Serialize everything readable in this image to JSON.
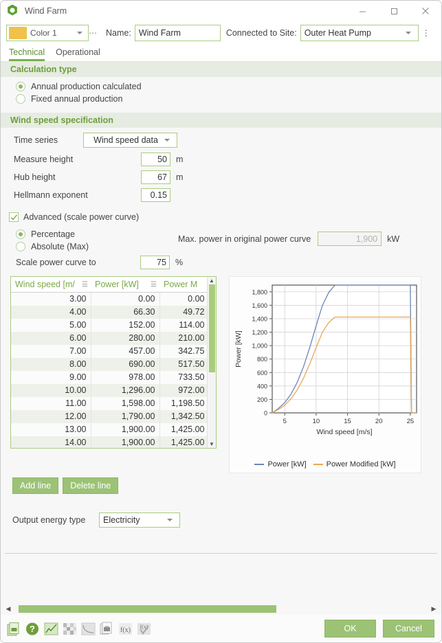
{
  "window": {
    "title": "Wind Farm",
    "icon": "hexagon-icon",
    "minimize": "–",
    "maximize": "□",
    "close": "✕"
  },
  "header": {
    "color_label": "Color 1",
    "color_swatch_hex": "#f0c24b",
    "name_label": "Name:",
    "name_value": "Wind Farm",
    "site_label": "Connected to Site:",
    "site_value": "Outer Heat Pump"
  },
  "tabs": [
    {
      "label": "Technical",
      "active": true
    },
    {
      "label": "Operational",
      "active": false
    }
  ],
  "calculation_type": {
    "group_title": "Calculation type",
    "options": [
      {
        "label": "Annual production calculated",
        "selected": true
      },
      {
        "label": "Fixed annual production",
        "selected": false
      }
    ]
  },
  "wind_speed": {
    "group_title": "Wind speed specification",
    "time_series_label": "Time series",
    "time_series_value": "Wind speed data",
    "fields": [
      {
        "label": "Measure height",
        "value": "50",
        "unit": "m"
      },
      {
        "label": "Hub height",
        "value": "67",
        "unit": "m"
      },
      {
        "label": "Hellmann exponent",
        "value": "0.15",
        "unit": ""
      }
    ]
  },
  "advanced": {
    "checkbox_label": "Advanced (scale power curve)",
    "checked": true,
    "scale_mode": [
      {
        "label": "Percentage",
        "selected": true
      },
      {
        "label": "Absolute (Max)",
        "selected": false
      }
    ],
    "max_power_label": "Max. power in original power curve",
    "max_power_value": "1,900",
    "max_power_unit": "kW",
    "scale_to_label": "Scale power curve to",
    "scale_to_value": "75",
    "scale_to_unit": "%"
  },
  "table": {
    "columns": [
      "Wind speed [m/",
      "Power [kW]",
      "Power M"
    ],
    "rows": [
      [
        "3.00",
        "0.00",
        "0.00"
      ],
      [
        "4.00",
        "66.30",
        "49.72"
      ],
      [
        "5.00",
        "152.00",
        "114.00"
      ],
      [
        "6.00",
        "280.00",
        "210.00"
      ],
      [
        "7.00",
        "457.00",
        "342.75"
      ],
      [
        "8.00",
        "690.00",
        "517.50"
      ],
      [
        "9.00",
        "978.00",
        "733.50"
      ],
      [
        "10.00",
        "1,296.00",
        "972.00"
      ],
      [
        "11.00",
        "1,598.00",
        "1,198.50"
      ],
      [
        "12.00",
        "1,790.00",
        "1,342.50"
      ],
      [
        "13.00",
        "1,900.00",
        "1,425.00"
      ],
      [
        "14.00",
        "1,900.00",
        "1,425.00"
      ]
    ],
    "add_line": "Add line",
    "delete_line": "Delete line"
  },
  "chart_data": {
    "type": "line",
    "title": "",
    "xlabel": "Wind speed [m/s]",
    "ylabel": "Power [kW]",
    "xlim": [
      3,
      26
    ],
    "ylim": [
      0,
      1900
    ],
    "xticks": [
      5,
      10,
      15,
      20,
      25
    ],
    "yticks": [
      0,
      200,
      400,
      600,
      800,
      1000,
      1200,
      1400,
      1600,
      1800
    ],
    "ytick_labels": [
      "0",
      "200",
      "400",
      "600",
      "800",
      "1,000",
      "1,200",
      "1,400",
      "1,600",
      "1,800"
    ],
    "grid": true,
    "legend_position": "bottom",
    "x": [
      3,
      4,
      5,
      6,
      7,
      8,
      9,
      10,
      11,
      12,
      13,
      14,
      15,
      16,
      17,
      18,
      19,
      20,
      21,
      22,
      23,
      24,
      25,
      25.2,
      26
    ],
    "series": [
      {
        "name": "Power [kW]",
        "color": "#6b85b5",
        "values": [
          0,
          66.3,
          152,
          280,
          457,
          690,
          978,
          1296,
          1598,
          1790,
          1900,
          1900,
          1900,
          1900,
          1900,
          1900,
          1900,
          1900,
          1900,
          1900,
          1900,
          1900,
          1900,
          0,
          0
        ]
      },
      {
        "name": "Power Modified [kW]",
        "color": "#e8a857",
        "values": [
          0,
          49.72,
          114,
          210,
          342.75,
          517.5,
          733.5,
          972,
          1198.5,
          1342.5,
          1425,
          1425,
          1425,
          1425,
          1425,
          1425,
          1425,
          1425,
          1425,
          1425,
          1425,
          1425,
          1425,
          0,
          0
        ]
      }
    ]
  },
  "output": {
    "label": "Output energy type",
    "value": "Electricity"
  },
  "footer": {
    "toolbar_icons": [
      "copy-document-icon",
      "help-icon",
      "chart-icon",
      "grid-icon",
      "curve-icon",
      "print-icon",
      "function-icon",
      "function-check-icon"
    ],
    "ok": "OK",
    "cancel": "Cancel"
  },
  "scrollbars": {
    "left_arrow": "◀",
    "right_arrow": "▶",
    "up_arrow": "▲",
    "down_arrow": "▼"
  }
}
